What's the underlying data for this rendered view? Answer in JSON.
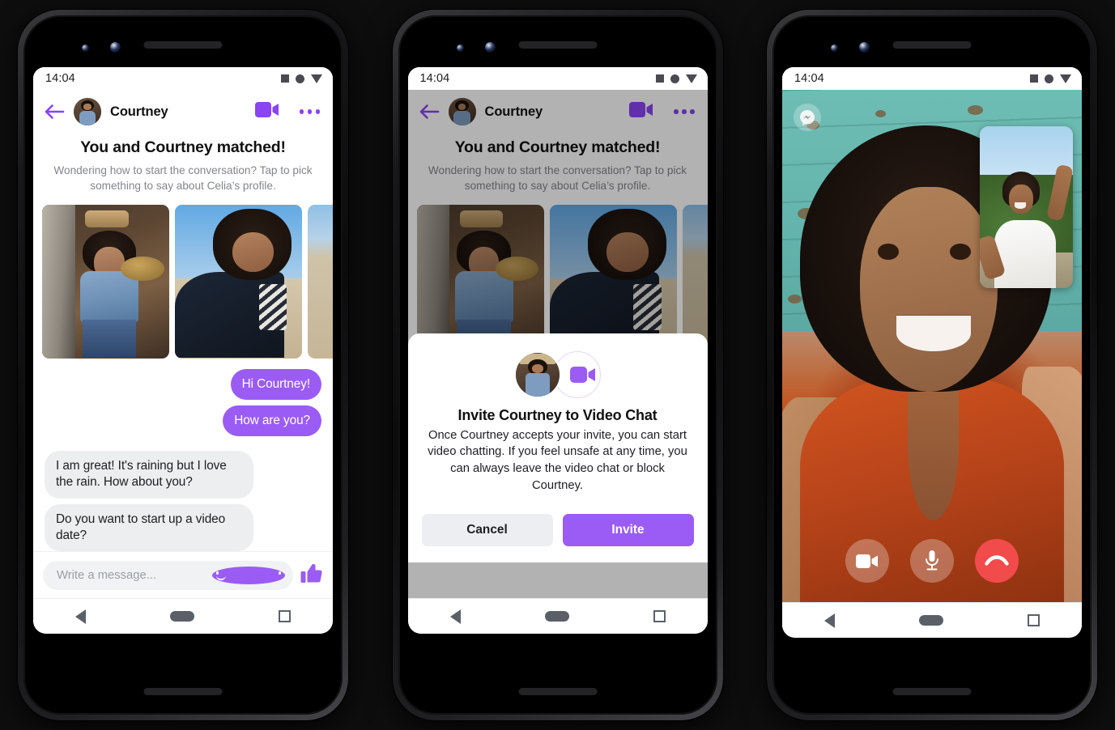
{
  "status_bar": {
    "time": "14:04",
    "icons": [
      "square-icon",
      "circle-icon",
      "triangle-down-icon"
    ]
  },
  "colors": {
    "accent_purple": "#9a5cf5",
    "header_purple": "#8a44f2",
    "incoming_bubble": "#eceef0",
    "end_call_red": "#f24b4b",
    "modal_cancel": "#edeef1"
  },
  "phone1": {
    "header": {
      "back": "back-arrow-icon",
      "name": "Courtney",
      "video_call": "video-camera-icon",
      "more": "more-options-icon"
    },
    "match": {
      "title": "You and Courtney matched!",
      "subtitle": "Wondering how to start the conversation? Tap to pick something to say about Celia’s profile."
    },
    "photos": [
      {
        "alt": "Courtney sitting in van doorway holding sunglasses"
      },
      {
        "alt": "Courtney smiling selfie at the beach"
      },
      {
        "alt": "Beach photo partially visible"
      }
    ],
    "messages": [
      {
        "side": "out",
        "text": "Hi Courtney!"
      },
      {
        "side": "out",
        "text": "How are you?"
      },
      {
        "side": "in",
        "text": "I am great! It's raining but I love the rain. How about you?"
      },
      {
        "side": "in",
        "text": "Do you want to start up a video date?"
      }
    ],
    "composer": {
      "placeholder": "Write a message...",
      "emoji": "smiley-icon",
      "like": "thumbs-up-icon"
    },
    "navbar": {
      "back": "nav-back-icon",
      "home": "nav-home-icon",
      "recents": "nav-recents-icon"
    }
  },
  "phone2": {
    "header": {
      "back": "back-arrow-icon",
      "name": "Courtney",
      "video_call": "video-camera-icon",
      "more": "more-options-icon"
    },
    "match": {
      "title": "You and Courtney matched!",
      "subtitle": "Wondering how to start the conversation? Tap to pick something to say about Celia’s profile."
    },
    "modal": {
      "avatar": "courtney-avatar",
      "video_icon": "video-camera-icon",
      "title": "Invite Courtney to Video Chat",
      "body": "Once Courtney accepts your invite, you can start video chatting. If you feel unsafe at any time, you can always leave the video chat or block Courtney.",
      "cancel_label": "Cancel",
      "invite_label": "Invite"
    },
    "navbar": {
      "back": "nav-back-icon",
      "home": "nav-home-icon",
      "recents": "nav-recents-icon"
    }
  },
  "phone3": {
    "badge": "messenger-logo-icon",
    "main_video_alt": "Woman smiling on video call in orange top against teal wall",
    "pip_video_alt": "Man in white t-shirt waving outdoors",
    "controls": [
      {
        "name": "toggle-camera-button",
        "icon": "video-camera-icon"
      },
      {
        "name": "toggle-microphone-button",
        "icon": "microphone-icon"
      },
      {
        "name": "end-call-button",
        "icon": "hang-up-icon"
      }
    ],
    "navbar": {
      "back": "nav-back-icon",
      "home": "nav-home-icon",
      "recents": "nav-recents-icon"
    }
  }
}
